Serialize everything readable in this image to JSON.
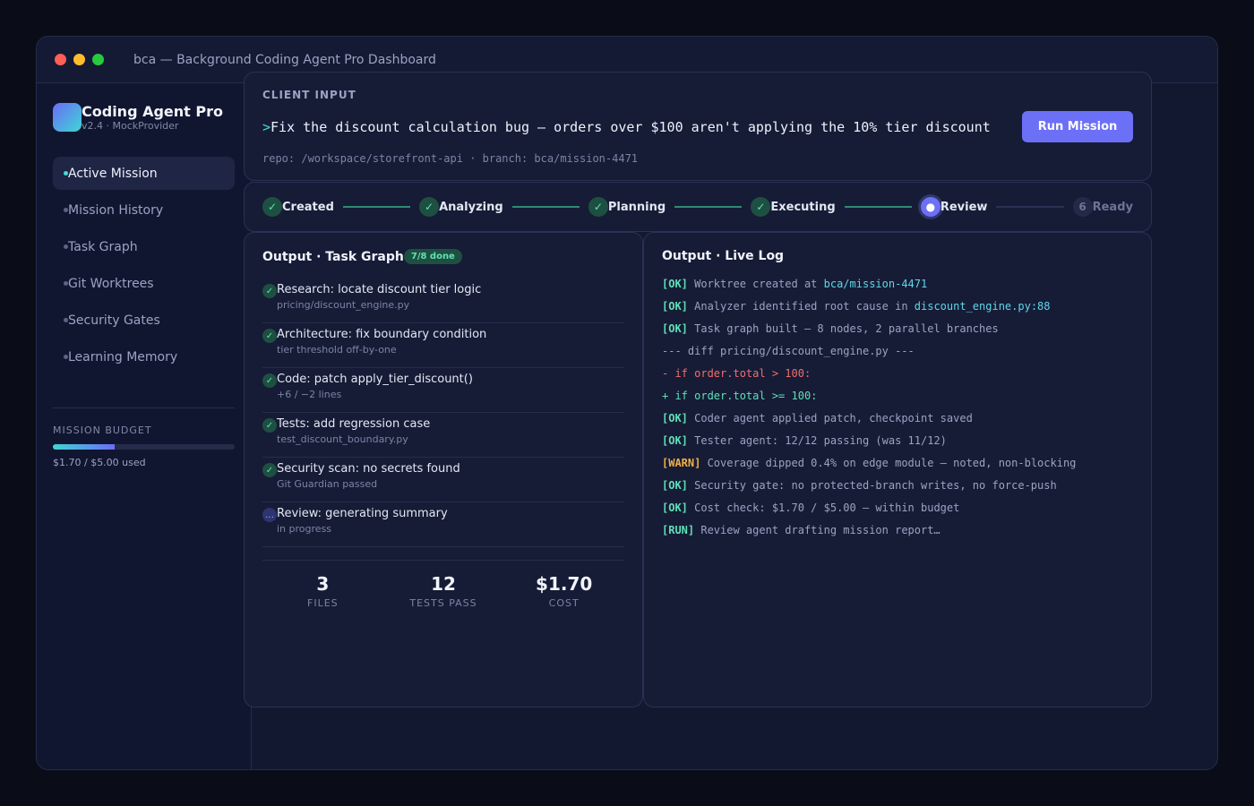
{
  "window": {
    "title": "bca — Background Coding Agent Pro Dashboard"
  },
  "brand": {
    "title": "Coding Agent Pro",
    "subtitle": "v2.4 · MockProvider"
  },
  "sidebar": {
    "items": [
      {
        "label": "Active Mission",
        "active": true
      },
      {
        "label": "Mission History",
        "active": false
      },
      {
        "label": "Task Graph",
        "active": false
      },
      {
        "label": "Git Worktrees",
        "active": false
      },
      {
        "label": "Security Gates",
        "active": false
      },
      {
        "label": "Learning Memory",
        "active": false
      }
    ],
    "budget": {
      "label": "MISSION BUDGET",
      "text": "$1.70 / $5.00 used",
      "fraction": 0.34
    }
  },
  "client_input": {
    "label": "CLIENT INPUT",
    "caret": ">",
    "prompt": "Fix the discount calculation bug — orders over $100 aren't applying the 10% tier discount",
    "run_button": "Run Mission",
    "meta": "repo: /workspace/storefront-api  ·  branch: bca/mission-4471"
  },
  "steps": [
    {
      "icon": "✓",
      "label": "Created",
      "state": "done"
    },
    {
      "icon": "✓",
      "label": "Analyzing",
      "state": "done"
    },
    {
      "icon": "✓",
      "label": "Planning",
      "state": "done"
    },
    {
      "icon": "✓",
      "label": "Executing",
      "state": "done"
    },
    {
      "icon": "●",
      "label": "Review",
      "state": "current"
    },
    {
      "icon": "6",
      "label": "Ready",
      "state": "pending"
    }
  ],
  "task_graph": {
    "title": "Output · Task Graph",
    "badge": "7/8 done",
    "tasks": [
      {
        "icon": "✓",
        "title": "Research: locate discount tier logic",
        "sub": "pricing/discount_engine.py"
      },
      {
        "icon": "✓",
        "title": "Architecture: fix boundary condition",
        "sub": "tier threshold off-by-one"
      },
      {
        "icon": "✓",
        "title": "Code: patch apply_tier_discount()",
        "sub": "+6 / −2 lines"
      },
      {
        "icon": "✓",
        "title": "Tests: add regression case",
        "sub": "test_discount_boundary.py"
      },
      {
        "icon": "✓",
        "title": "Security scan: no secrets found",
        "sub": "Git Guardian passed"
      },
      {
        "icon": "…",
        "title": "Review: generating summary",
        "sub": "in progress"
      }
    ],
    "stats": [
      {
        "value": "3",
        "label": "FILES"
      },
      {
        "value": "12",
        "label": "TESTS PASS"
      },
      {
        "value": "$1.70",
        "label": "COST"
      }
    ]
  },
  "live_log": {
    "title": "Output · Live Log",
    "lines": [
      {
        "tag": "[OK]",
        "text": " Worktree created at ",
        "hl": "bca/mission-4471"
      },
      {
        "tag": "[OK]",
        "text": " Analyzer identified root cause in ",
        "hl": "discount_engine.py:88"
      },
      {
        "tag": "[OK]",
        "text": " Task graph built — 8 nodes, 2 parallel branches"
      },
      {
        "text": "--- diff pricing/discount_engine.py ---"
      },
      {
        "del": "- if order.total > 100:"
      },
      {
        "add": "+ if order.total >= 100:"
      },
      {
        "tag": "[OK]",
        "text": " Coder agent applied patch, checkpoint saved"
      },
      {
        "tag": "[OK]",
        "text": " Tester agent: 12/12 passing (was 11/12)"
      },
      {
        "warn": "[WARN]",
        "text": " Coverage dipped 0.4% on edge module — noted, non-blocking"
      },
      {
        "tag": "[OK]",
        "text": " Security gate: no protected-branch writes, no force-push"
      },
      {
        "tag": "[OK]",
        "text": " Cost check: $1.70 / $5.00 — within budget"
      },
      {
        "run": "[RUN]",
        "text": " Review agent drafting mission report…"
      }
    ]
  }
}
